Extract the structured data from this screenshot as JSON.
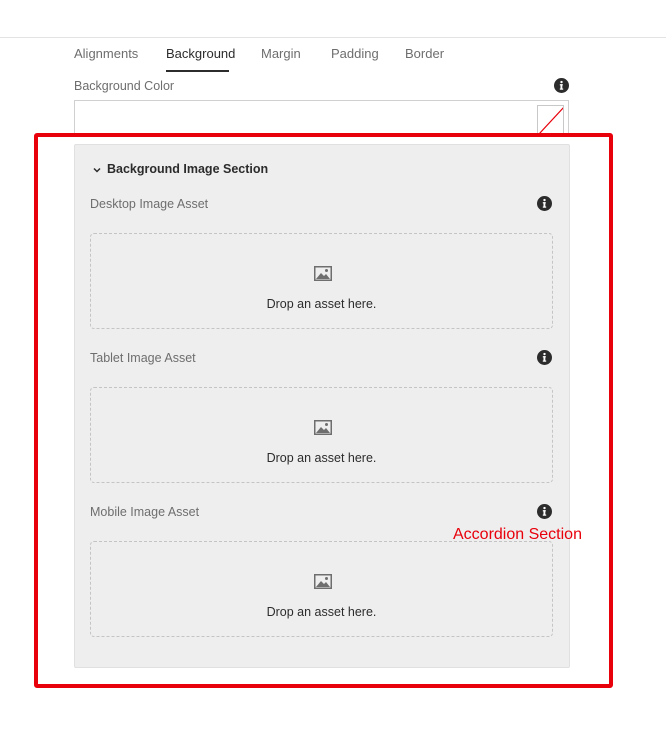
{
  "tabs": [
    {
      "label": "Alignments",
      "active": false
    },
    {
      "label": "Background",
      "active": true
    },
    {
      "label": "Margin",
      "active": false
    },
    {
      "label": "Padding",
      "active": false
    },
    {
      "label": "Border",
      "active": false
    }
  ],
  "background_color": {
    "label": "Background Color",
    "value": ""
  },
  "accordion": {
    "title": "Background Image Section",
    "expanded": true,
    "fields": [
      {
        "label": "Desktop Image Asset",
        "drop_text": "Drop an asset here."
      },
      {
        "label": "Tablet Image Asset",
        "drop_text": "Drop an asset here."
      },
      {
        "label": "Mobile Image Asset",
        "drop_text": "Drop an asset here."
      }
    ]
  },
  "annotation": {
    "label": "Accordion Section",
    "color": "#e8000b"
  },
  "colors": {
    "text": "#2c2c2c",
    "muted": "#6e6e6e",
    "panel": "#eeeeee",
    "highlight": "#e8000b"
  },
  "icons": {
    "info": "info-icon",
    "chevron": "chevron-down-icon",
    "image": "image-icon",
    "no-color": "no-color-swatch-icon"
  }
}
